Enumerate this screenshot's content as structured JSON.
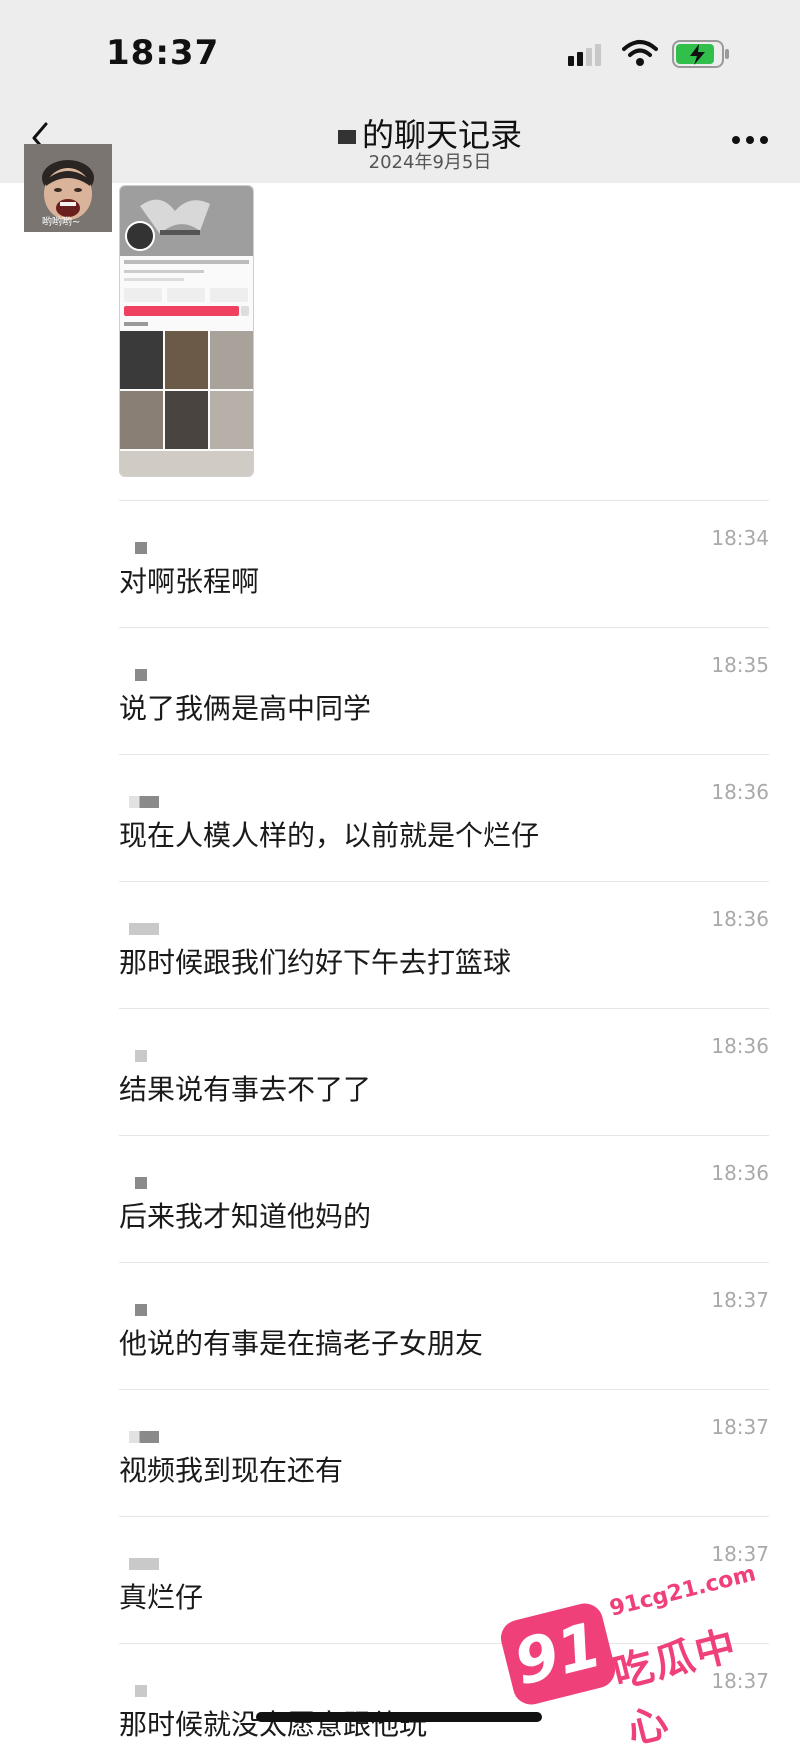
{
  "status_bar": {
    "time": "18:37"
  },
  "nav": {
    "title": "的聊天记录",
    "subtitle": "2024年9月5日"
  },
  "avatar": {
    "caption": "哟哟哟~"
  },
  "messages": [
    {
      "time": "18:34",
      "text": "对啊张程啊"
    },
    {
      "time": "18:35",
      "text": "说了我俩是高中同学"
    },
    {
      "time": "18:36",
      "text": "现在人模人样的，以前就是个烂仔"
    },
    {
      "time": "18:36",
      "text": "那时候跟我们约好下午去打篮球"
    },
    {
      "time": "18:36",
      "text": "结果说有事去不了了"
    },
    {
      "time": "18:36",
      "text": "后来我才知道他妈的"
    },
    {
      "time": "18:37",
      "text": "他说的有事是在搞老子女朋友"
    },
    {
      "time": "18:37",
      "text": "视频我到现在还有"
    },
    {
      "time": "18:37",
      "text": "真烂仔"
    },
    {
      "time": "18:37",
      "text": "那时候就没太愿意跟他玩"
    }
  ],
  "watermark": {
    "number": "91",
    "url": "91cg21.com",
    "name": "吃瓜中心"
  },
  "colors": {
    "header_bg": "#ededed",
    "timestamp": "#a9a9a9",
    "watermark": "#f0407a"
  }
}
